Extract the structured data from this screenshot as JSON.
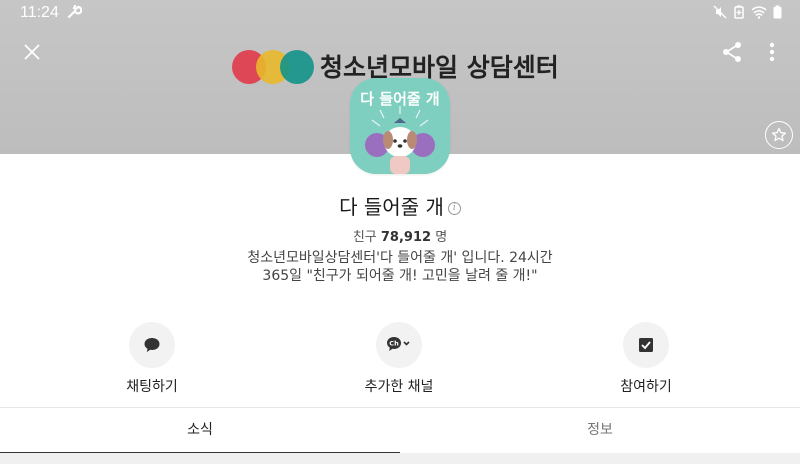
{
  "status_bar": {
    "time": "11:24",
    "icons": [
      "wrench-icon",
      "mute-icon",
      "battery-saver-icon",
      "wifi-icon",
      "battery-icon"
    ]
  },
  "header": {
    "brand_text": "청소년모바일 상담센터",
    "brand_colors": [
      "#e03a4a",
      "#e9b82a",
      "#13938a"
    ],
    "background": "#c4c4c4",
    "icons": [
      "close-icon",
      "share-icon",
      "more-icon",
      "star-icon"
    ]
  },
  "profile": {
    "avatar_text": "다 들어줄 개",
    "avatar_bg": "#7ecfbf",
    "name": "다 들어줄 개",
    "friends_label": "친구",
    "friends_count": "78,912",
    "friends_unit": "명",
    "description": "청소년모바일상담센터'다 들어줄 개' 입니다. 24시간 365일 \"친구가 되어줄 개! 고민을 날려 줄 개!\""
  },
  "actions": [
    {
      "label": "채팅하기",
      "icon": "chat-icon"
    },
    {
      "label": "추가한 채널",
      "icon": "channel-added-icon"
    },
    {
      "label": "참여하기",
      "icon": "checkbox-icon"
    }
  ],
  "tabs": [
    {
      "label": "소식",
      "active": true
    },
    {
      "label": "정보",
      "active": false
    }
  ]
}
